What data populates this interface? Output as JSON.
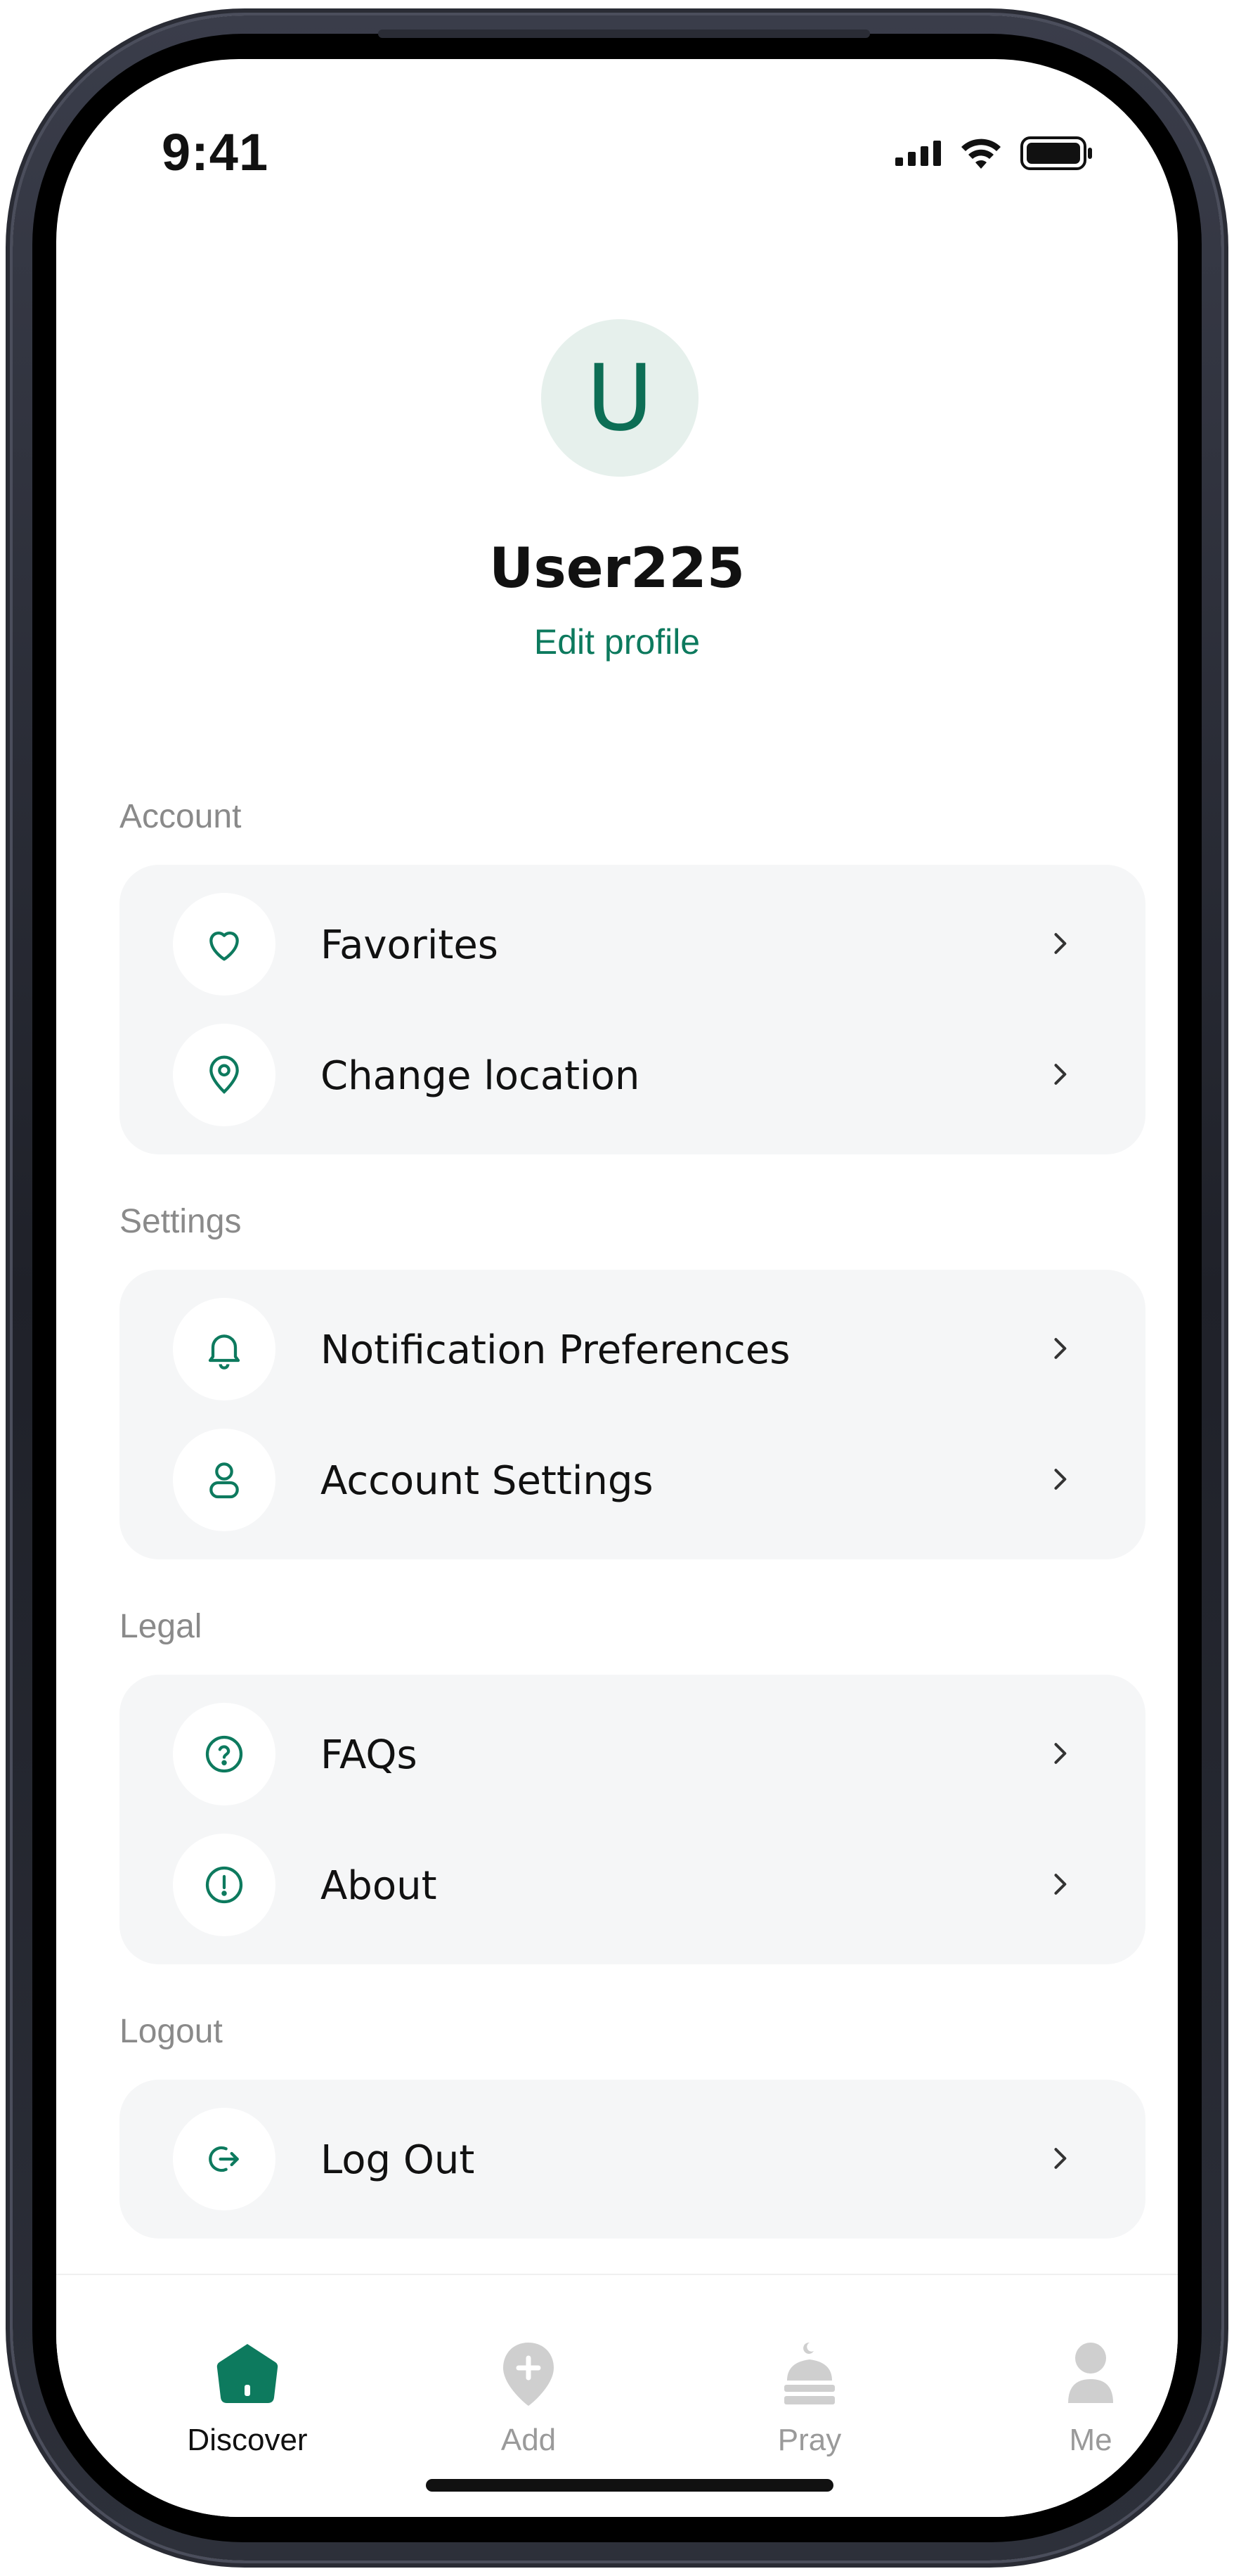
{
  "status_bar": {
    "time": "9:41"
  },
  "profile": {
    "avatar_initial": "U",
    "username": "User225",
    "edit_label": "Edit profile"
  },
  "sections": {
    "account": {
      "title": "Account",
      "items": [
        {
          "label": "Favorites",
          "icon": "heart-icon"
        },
        {
          "label": "Change location",
          "icon": "location-pin-icon"
        }
      ]
    },
    "settings": {
      "title": "Settings",
      "items": [
        {
          "label": "Notification Preferences",
          "icon": "bell-icon"
        },
        {
          "label": "Account Settings",
          "icon": "user-icon"
        }
      ]
    },
    "legal": {
      "title": "Legal",
      "items": [
        {
          "label": "FAQs",
          "icon": "question-circle-icon"
        },
        {
          "label": "About",
          "icon": "info-circle-icon"
        }
      ]
    },
    "logout": {
      "title": "Logout",
      "items": [
        {
          "label": "Log Out",
          "icon": "logout-icon"
        }
      ]
    }
  },
  "tab_bar": {
    "tabs": [
      {
        "label": "Discover",
        "icon": "home-icon",
        "active": true
      },
      {
        "label": "Add",
        "icon": "add-pin-icon",
        "active": false
      },
      {
        "label": "Pray",
        "icon": "mosque-icon",
        "active": false
      },
      {
        "label": "Me",
        "icon": "person-icon",
        "active": false
      }
    ]
  },
  "colors": {
    "accent": "#0d7a5e",
    "inactive": "#c7c7c7",
    "card_background": "#f5f6f7",
    "section_title": "#8a8a8a"
  }
}
